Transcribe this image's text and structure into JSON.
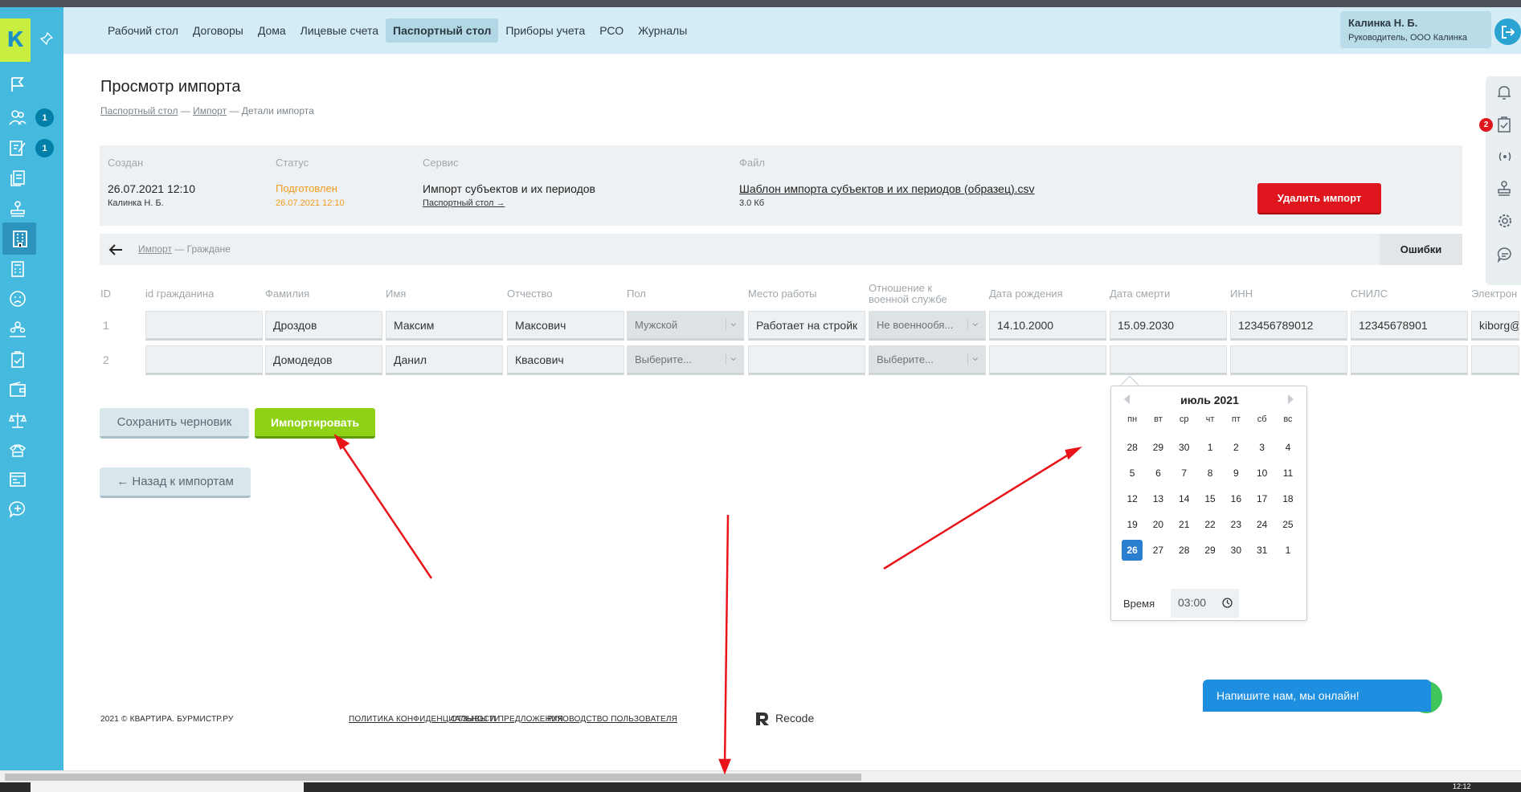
{
  "sidebar": {
    "logo_letter": "К",
    "badges": {
      "item2": "1",
      "item3": "1"
    }
  },
  "header": {
    "nav": [
      "Рабочий стол",
      "Договоры",
      "Дома",
      "Лицевые счета",
      "Паспортный стол",
      "Приборы учета",
      "РСО",
      "Журналы"
    ],
    "active_nav": "Паспортный стол",
    "user_name": "Калинка Н. Б.",
    "user_role": "Руководитель, ООО Калинка"
  },
  "page": {
    "title": "Просмотр импорта",
    "breadcrumb": {
      "part1": "Паспортный стол",
      "sep1": " — ",
      "part2": "Импорт",
      "sep2": " — Детали импорта"
    }
  },
  "info": {
    "created_label": "Создан",
    "created_value": "26.07.2021 12:10",
    "created_by": "Калинка Н. Б.",
    "status_label": "Статус",
    "status_value": "Подготовлен",
    "status_date": "26.07.2021 12:10",
    "service_label": "Сервис",
    "service_value": "Импорт субъектов и их периодов",
    "service_link": "Паспортный стол →",
    "file_label": "Файл",
    "file_name": "Шаблон импорта субъектов и их периодов (образец).csv",
    "file_size": "3.0 Кб",
    "delete_label": "Удалить импорт"
  },
  "subbar": {
    "crumb_link": "Импорт",
    "crumb_rest": " — Граждане",
    "errors_tab": "Ошибки"
  },
  "table": {
    "columns": [
      "ID",
      "id гражданина",
      "Фамилия",
      "Имя",
      "Отчество",
      "Пол",
      "Место работы",
      "Отношение к военной службе",
      "Дата рождения",
      "Дата смерти",
      "ИНН",
      "СНИЛС",
      "Электрон"
    ],
    "rows": [
      {
        "id": "1",
        "citizen_id": "",
        "last": "Дроздов",
        "first": "Максим",
        "middle": "Максович",
        "sex": "Мужской",
        "work": "Работает на стройк",
        "military": "Не военнообя...",
        "birth": "14.10.2000",
        "death": "15.09.2030",
        "inn": "123456789012",
        "snils": "12345678901",
        "email": "kiborg@"
      },
      {
        "id": "2",
        "citizen_id": "",
        "last": "Домодедов",
        "first": "Данил",
        "middle": "Квасович",
        "sex": "Выберите...",
        "work": "",
        "military": "Выберите...",
        "birth": "",
        "death": "",
        "inn": "",
        "snils": "",
        "email": ""
      }
    ]
  },
  "actions": {
    "save_draft": "Сохранить черновик",
    "import": "Импортировать",
    "back": "← Назад к импортам"
  },
  "datepicker": {
    "month": "июль 2021",
    "weekdays": [
      "пн",
      "вт",
      "ср",
      "чт",
      "пт",
      "сб",
      "вс"
    ],
    "days": [
      "28",
      "29",
      "30",
      "1",
      "2",
      "3",
      "4",
      "5",
      "6",
      "7",
      "8",
      "9",
      "10",
      "11",
      "12",
      "13",
      "14",
      "15",
      "16",
      "17",
      "18",
      "19",
      "20",
      "21",
      "22",
      "23",
      "24",
      "25",
      "26",
      "27",
      "28",
      "29",
      "30",
      "31",
      "1"
    ],
    "selected": "26",
    "time_label": "Время",
    "time_value": "03:00"
  },
  "footer": {
    "copyright": "2021 © КВАРТИРА. БУРМИСТР.РУ",
    "links": [
      "ПОЛИТИКА КОНФИДЕНЦИАЛЬНОСТИ",
      "ОТЗЫВЫ И ПРЕДЛОЖЕНИЯ",
      "РУКОВОДСТВО ПОЛЬЗОВАТЕЛЯ"
    ],
    "brand": "Recode"
  },
  "chat": {
    "label": "Напишите нам, мы онлайн!"
  },
  "rail": {
    "badge": "2"
  },
  "taskbar": {
    "time": "12:12"
  },
  "colors": {
    "sidebar": "#45b9de",
    "header": "#d4ecf5",
    "logo": "#c8ef3f",
    "status": "#f19c1e",
    "delete": "#e0161e",
    "import": "#8fd114",
    "selected_day": "#2b7fd1",
    "annotation_arrow": "#e8141a"
  }
}
